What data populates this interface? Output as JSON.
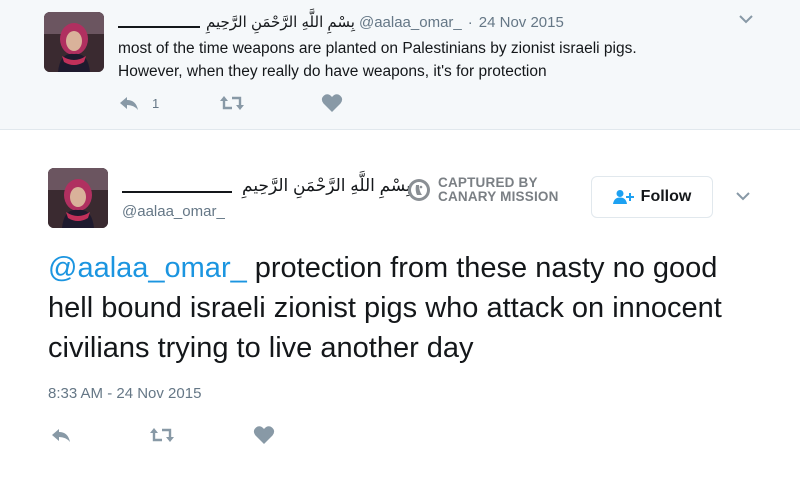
{
  "reply_tweet": {
    "arabic_name": "بِسْمِ اللَّهِ الرَّحْمَنِ الرَّحِيمِ",
    "handle": "@aalaa_omar_",
    "separator": "·",
    "date": "24 Nov 2015",
    "text_line1": "most of the time weapons are planted on Palestinians by zionist israeli pigs.",
    "text_line2": "However, when they really do have weapons, it's for protection",
    "reply_count": "1",
    "icons": [
      "reply-icon",
      "retweet-icon",
      "heart-icon",
      "chevron-down-icon"
    ]
  },
  "main_tweet": {
    "arabic_name": "بِسْمِ اللَّهِ الرَّحْمَنِ الرَّحِيمِ",
    "handle": "@aalaa_omar_",
    "watermark_line1": "CAPTURED BY",
    "watermark_line2": "CANARY MISSION",
    "follow_label": "Follow",
    "mention": "@aalaa_omar_",
    "text": "protection from these nasty no good hell bound israeli zionist pigs who attack on innocent civilians trying to live another day",
    "timestamp": "8:33 AM - 24 Nov 2015",
    "icons": [
      "reply-icon",
      "retweet-icon",
      "heart-icon",
      "chevron-down-icon",
      "add-user-icon"
    ]
  },
  "colors": {
    "link": "#1b95e0",
    "muted": "#657786",
    "icon": "#8899a6",
    "reply_bg": "#f5f8fa",
    "follow_icon": "#1da1f2"
  }
}
